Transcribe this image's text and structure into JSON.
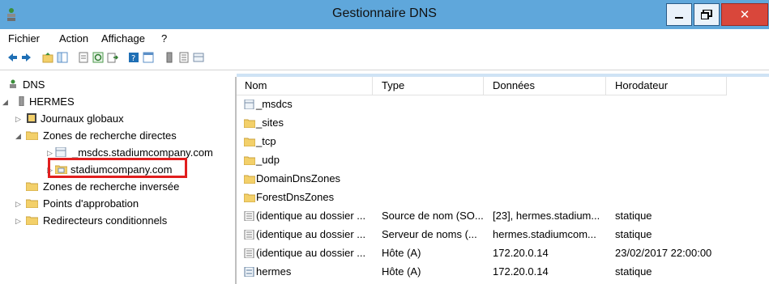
{
  "window": {
    "title": "Gestionnaire DNS"
  },
  "menu": [
    "Fichier",
    "Action",
    "Affichage",
    "?"
  ],
  "toolbar_icons": [
    "back-arrow-icon",
    "forward-arrow-icon",
    "folder-up-icon",
    "show-hide-tree-icon",
    "properties-icon",
    "refresh-icon",
    "export-list-icon",
    "help-icon",
    "console-icon",
    "server-icon",
    "list-icon",
    "zone-icon"
  ],
  "tree": {
    "root": "DNS",
    "server": "HERMES",
    "global_logs": "Journaux globaux",
    "forward_zones": "Zones de recherche directes",
    "zone_msdcs": "_msdcs.stadiumcompany.com",
    "zone_main": "stadiumcompany.com",
    "reverse_zones": "Zones de recherche inversée",
    "trust_points": "Points d'approbation",
    "conditional_forwarders": "Redirecteurs conditionnels"
  },
  "list": {
    "columns": [
      "Nom",
      "Type",
      "Données",
      "Horodateur"
    ],
    "rows": [
      {
        "icon": "delegated-folder",
        "name": "_msdcs",
        "type": "",
        "data": "",
        "timestamp": ""
      },
      {
        "icon": "folder",
        "name": "_sites",
        "type": "",
        "data": "",
        "timestamp": ""
      },
      {
        "icon": "folder",
        "name": "_tcp",
        "type": "",
        "data": "",
        "timestamp": ""
      },
      {
        "icon": "folder",
        "name": "_udp",
        "type": "",
        "data": "",
        "timestamp": ""
      },
      {
        "icon": "folder",
        "name": "DomainDnsZones",
        "type": "",
        "data": "",
        "timestamp": ""
      },
      {
        "icon": "folder",
        "name": "ForestDnsZones",
        "type": "",
        "data": "",
        "timestamp": ""
      },
      {
        "icon": "record",
        "name": "(identique au dossier ...",
        "type": "Source de nom (SO...",
        "data": "[23], hermes.stadium...",
        "timestamp": "statique"
      },
      {
        "icon": "record",
        "name": "(identique au dossier ...",
        "type": "Serveur de noms (...",
        "data": "hermes.stadiumcom...",
        "timestamp": "statique"
      },
      {
        "icon": "record",
        "name": "(identique au dossier ...",
        "type": "Hôte (A)",
        "data": "172.20.0.14",
        "timestamp": "23/02/2017 22:00:00"
      },
      {
        "icon": "host",
        "name": "hermes",
        "type": "Hôte (A)",
        "data": "172.20.0.14",
        "timestamp": "statique"
      }
    ]
  },
  "colors": {
    "titlebar": "#5fa7db",
    "highlight": "#e11e1e",
    "folder": "#f3d06a"
  }
}
